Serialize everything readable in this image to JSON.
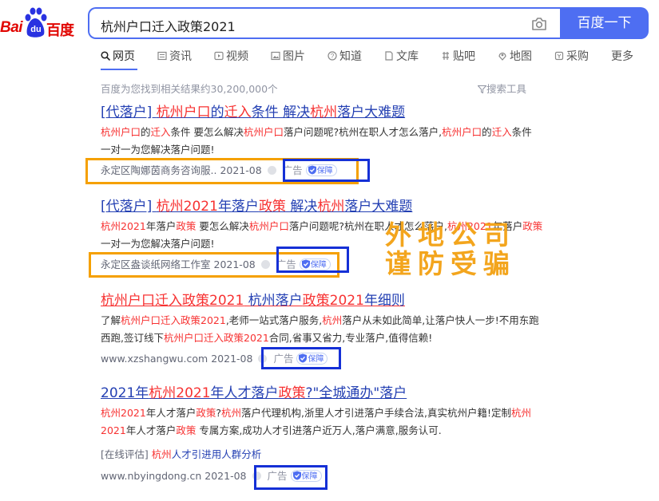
{
  "logo": {
    "bai": "Bai",
    "du": "du",
    "cn": "百度"
  },
  "search": {
    "query": "杭州户口迁入政策2021",
    "button": "百度一下"
  },
  "tabs": [
    {
      "label": "网页",
      "icon": "search-icon"
    },
    {
      "label": "资讯",
      "icon": "news-icon"
    },
    {
      "label": "视频",
      "icon": "video-icon"
    },
    {
      "label": "图片",
      "icon": "image-icon"
    },
    {
      "label": "知道",
      "icon": "question-icon"
    },
    {
      "label": "文库",
      "icon": "document-icon"
    },
    {
      "label": "贴吧",
      "icon": "tieba-icon"
    },
    {
      "label": "地图",
      "icon": "map-icon"
    },
    {
      "label": "采购",
      "icon": "purchase-icon"
    },
    {
      "label": "更多",
      "icon": ""
    }
  ],
  "stats": {
    "count": "百度为您找到相关结果约30,200,000个",
    "tools": "搜索工具"
  },
  "results": [
    {
      "title_parts": [
        "[代落户] ",
        "杭州户口",
        "的",
        "迁入",
        "条件 解决",
        "杭州",
        "落户大难题"
      ],
      "desc_parts": [
        "杭州户口",
        "的",
        "迁入",
        "条件 要怎么解决",
        "杭州户口",
        "落户问题呢?杭州在职人才怎么落户,",
        "杭州户口",
        "的",
        "迁入",
        "条件 一对一为您解决落户问题!"
      ],
      "source": "永定区陶娜茵商务咨询服..",
      "date": "2021-08",
      "ad": "广告",
      "badge": "保障"
    },
    {
      "title_parts": [
        "[代落户] ",
        "杭州2021",
        "年落户",
        "政策",
        " 解决",
        "杭州",
        "落户大难题"
      ],
      "desc_parts": [
        "杭州2021",
        "年落户",
        "政策",
        " 要怎么解决",
        "杭州户口",
        "落户问题呢?杭州在职人才怎么落户,",
        "杭州2021",
        "年落户",
        "政策",
        " 一对一为您解决落户问题!"
      ],
      "source": "永定区盎谈纸网络工作室",
      "date": "2021-08",
      "ad": "广告",
      "badge": "保障"
    },
    {
      "title_parts": [
        "杭州户口迁入政策2021",
        " 杭州落户",
        "政策2021",
        "年细则"
      ],
      "desc_parts": [
        "了解",
        "杭州户口迁入政策2021",
        ",老师一站式落户服务,",
        "杭州",
        "落户从未如此简单,让落户快人一步!不用东跑西跑,签订线下",
        "杭州户口迁入政策2021",
        "合同,省事又省力,专业落户,值得信赖!"
      ],
      "source": "www.xzshangwu.com",
      "date": "2021-08",
      "ad": "广告",
      "badge": "保障"
    },
    {
      "title_parts": [
        "2021年",
        "杭州2021",
        "年人才落户",
        "政策",
        "?\"全城通办\"落户"
      ],
      "desc_parts": [
        "杭州2021",
        "年人才落户",
        "政策",
        "?",
        "杭州",
        "落户代理机构,浙里人才引进落户手续合法,真实杭州户籍!定制",
        "杭州2021",
        "年人才落户",
        "政策",
        " 专属方案,成功人才引进落户近万人,落户满意,服务认可."
      ],
      "eval_prefix": "[在线评估] ",
      "eval_hl": "杭州",
      "eval_rest": "人才引进用人群分析",
      "source": "www.nbyingdong.cn",
      "date": "2021-08",
      "ad": "广告",
      "badge": "保障"
    }
  ],
  "warning": {
    "line1": "外地公司",
    "line2": "谨防受骗"
  },
  "colors": {
    "brand_blue": "#4e6ef2",
    "link": "#2440b3",
    "highlight": "#f73131",
    "annotation_orange": "#f5a000",
    "annotation_blue": "#1530d6"
  }
}
